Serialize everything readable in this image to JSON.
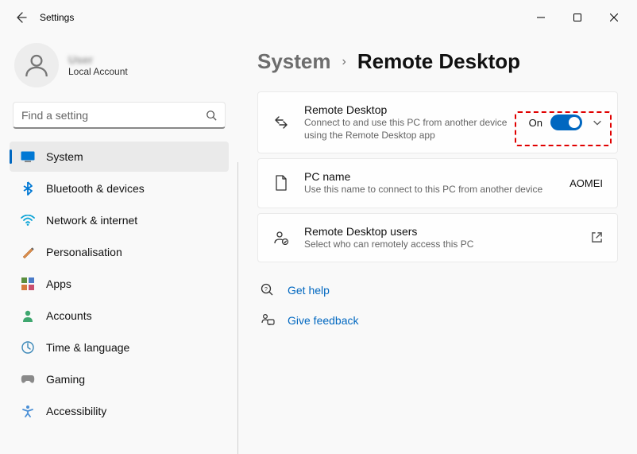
{
  "titlebar": {
    "title": "Settings"
  },
  "user": {
    "name": "User",
    "sub": "Local Account"
  },
  "search": {
    "placeholder": "Find a setting"
  },
  "sidebar": {
    "items": [
      {
        "label": "System"
      },
      {
        "label": "Bluetooth & devices"
      },
      {
        "label": "Network & internet"
      },
      {
        "label": "Personalisation"
      },
      {
        "label": "Apps"
      },
      {
        "label": "Accounts"
      },
      {
        "label": "Time & language"
      },
      {
        "label": "Gaming"
      },
      {
        "label": "Accessibility"
      }
    ]
  },
  "breadcrumb": {
    "parent": "System",
    "current": "Remote Desktop"
  },
  "cards": {
    "remote": {
      "title": "Remote Desktop",
      "sub": "Connect to and use this PC from another device using the Remote Desktop app",
      "toggle_label": "On"
    },
    "pcname": {
      "title": "PC name",
      "sub": "Use this name to connect to this PC from another device",
      "value": "AOMEI"
    },
    "users": {
      "title": "Remote Desktop users",
      "sub": "Select who can remotely access this PC"
    }
  },
  "links": {
    "help": "Get help",
    "feedback": "Give feedback"
  }
}
